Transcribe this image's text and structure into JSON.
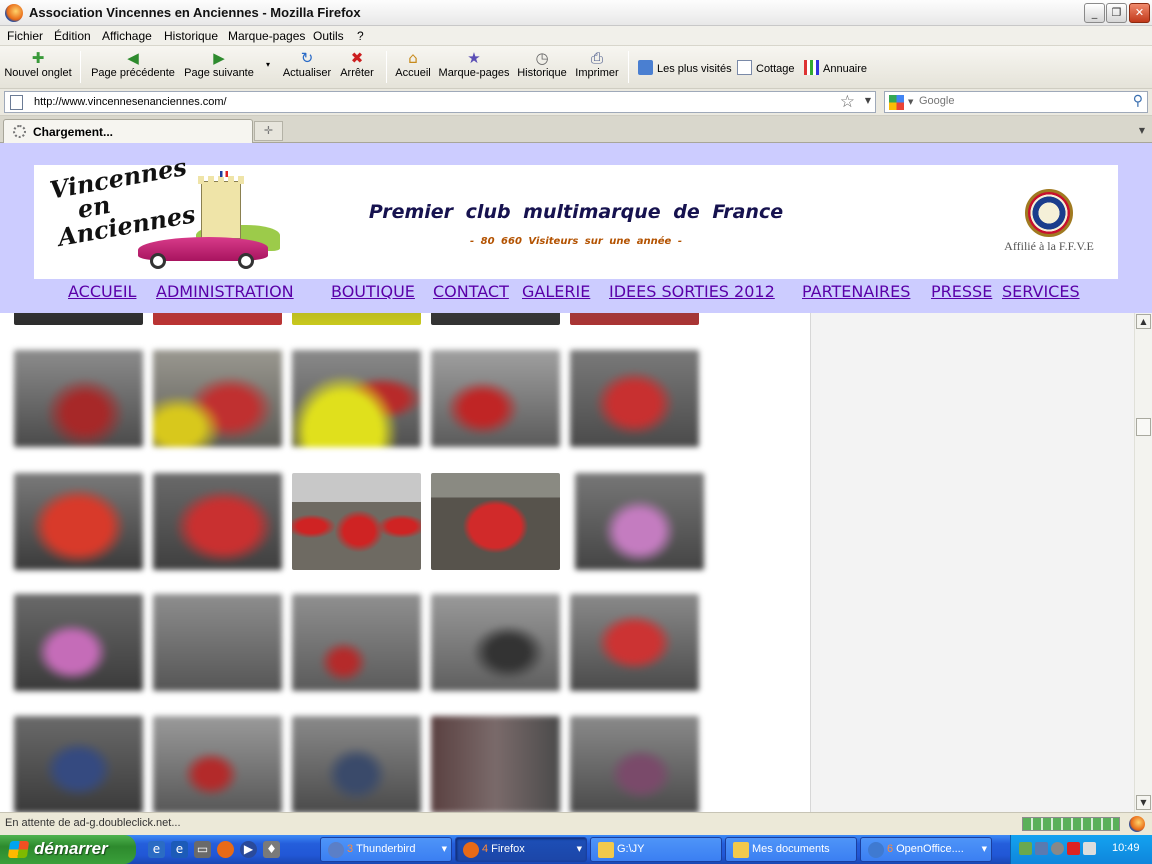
{
  "window": {
    "title": "Association Vincennes en Anciennes - Mozilla Firefox",
    "buttons": {
      "minimize": "_",
      "maximize": "❐",
      "close": "✕"
    }
  },
  "menu": [
    "Fichier",
    "Édition",
    "Affichage",
    "Historique",
    "Marque-pages",
    "Outils",
    "?"
  ],
  "toolbar": {
    "new_tab": "Nouvel onglet",
    "back": "Page précédente",
    "forward": "Page suivante",
    "reload": "Actualiser",
    "stop": "Arrêter",
    "home": "Accueil",
    "bookmarks": "Marque-pages",
    "history": "Historique",
    "print": "Imprimer",
    "bookmark_links": [
      "Les plus visités",
      "Cottage",
      "Annuaire"
    ]
  },
  "address": {
    "url": "http://www.vincennesenanciennes.com/",
    "search_placeholder": "Google"
  },
  "tabs": [
    {
      "label": "Chargement...",
      "loading": true
    }
  ],
  "site": {
    "logo_text_lines": [
      "Vincennes",
      "en",
      "Anciennes"
    ],
    "headline": "Premier club multimarque de France",
    "visitors": "- 80 660 Visiteurs sur une année -",
    "affiliation": "Affilié à la F.F.V.E",
    "nav": [
      "ACCUEIL",
      "ADMINISTRATION",
      "BOUTIQUE",
      "CONTACT",
      "GALERIE",
      "IDEES SORTIES 2012",
      "PARTENAIRES",
      "PRESSE",
      "SERVICES"
    ],
    "nav_color": "#5a00a8",
    "header_bg": "#ccccff"
  },
  "gallery": {
    "rows": 5,
    "columns": 5,
    "thumbs_visible": 25,
    "blurred_thumbs": 21
  },
  "status": {
    "text": "En attente de ad-g.doubleclick.net..."
  },
  "taskbar": {
    "start_label": "démarrer",
    "tasks": [
      {
        "count": "3",
        "label": "Thunderbird",
        "icon_color": "#5b7fc7",
        "active": false
      },
      {
        "count": "4",
        "label": "Firefox",
        "icon_color": "#e86a17",
        "active": true
      },
      {
        "count": "",
        "label": "G:\\JY",
        "icon_color": "#f2c94c",
        "active": false
      },
      {
        "count": "",
        "label": "Mes documents",
        "icon_color": "#f2c94c",
        "active": false
      },
      {
        "count": "6",
        "label": "OpenOffice....",
        "icon_color": "#3f7ad1",
        "active": false
      }
    ],
    "clock": "10:49"
  }
}
